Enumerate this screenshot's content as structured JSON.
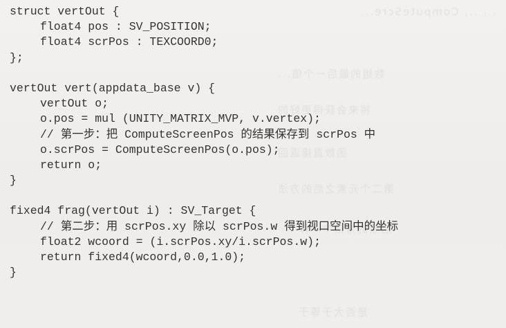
{
  "code_lines": [
    {
      "text": "struct vertOut {",
      "indent": 0
    },
    {
      "text": "float4 pos : SV_POSITION;",
      "indent": 1
    },
    {
      "text": "float4 scrPos : TEXCOORD0;",
      "indent": 1
    },
    {
      "text": "};",
      "indent": 0
    },
    {
      "text": "",
      "indent": 0
    },
    {
      "text": "vertOut vert(appdata_base v) {",
      "indent": 0
    },
    {
      "text": "vertOut o;",
      "indent": 1
    },
    {
      "text": "o.pos = mul (UNITY_MATRIX_MVP, v.vertex);",
      "indent": 1
    },
    {
      "text": "// 第一步：把 ComputeScreenPos 的结果保存到 scrPos 中",
      "indent": 1
    },
    {
      "text": "o.scrPos = ComputeScreenPos(o.pos);",
      "indent": 1
    },
    {
      "text": "return o;",
      "indent": 1
    },
    {
      "text": "}",
      "indent": 0
    },
    {
      "text": "",
      "indent": 0
    },
    {
      "text": "fixed4 frag(vertOut i) : SV_Target {",
      "indent": 0
    },
    {
      "text": "// 第二步：用 scrPos.xy 除以 scrPos.w 得到视口空间中的坐标",
      "indent": 1
    },
    {
      "text": "float2 wcoord = (i.scrPos.xy/i.scrPos.w);",
      "indent": 1
    },
    {
      "text": "return fixed4(wcoord,0.0,1.0);",
      "indent": 1
    },
    {
      "text": "}",
      "indent": 0
    }
  ]
}
